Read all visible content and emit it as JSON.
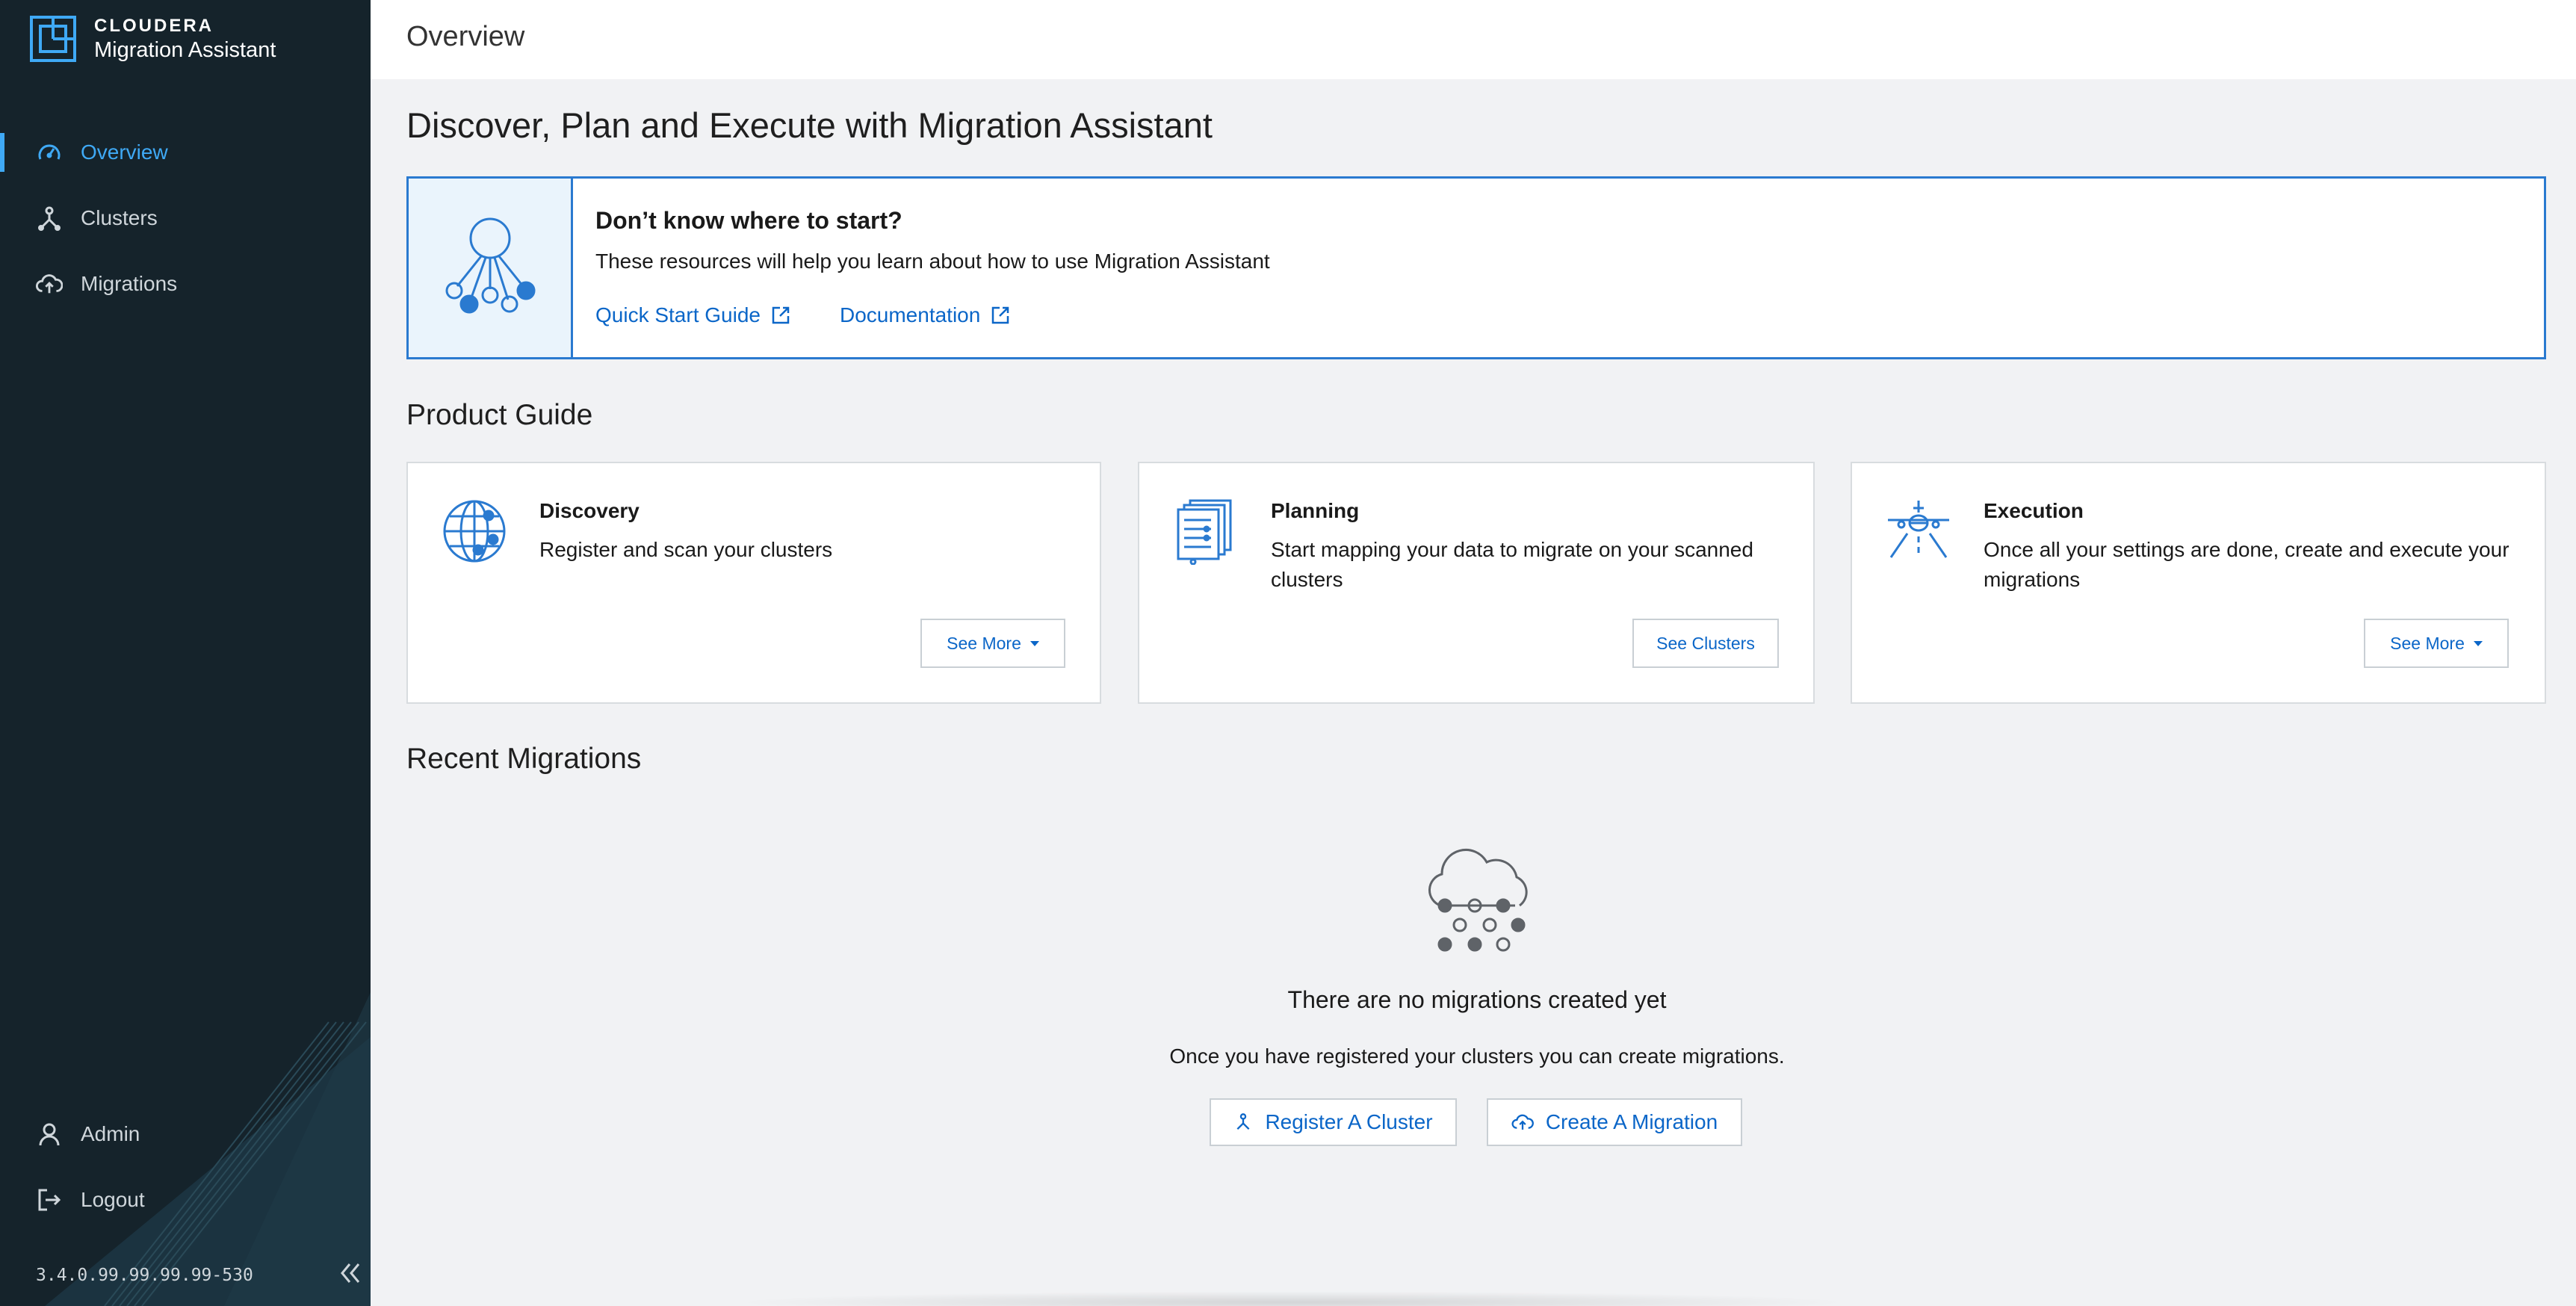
{
  "brand": {
    "top": "CLOUDERA",
    "sub": "Migration Assistant"
  },
  "sidebar": {
    "items": [
      {
        "label": "Overview",
        "icon": "speedometer-icon",
        "active": true
      },
      {
        "label": "Clusters",
        "icon": "cluster-icon",
        "active": false
      },
      {
        "label": "Migrations",
        "icon": "cloud-upload-icon",
        "active": false
      }
    ],
    "bottom": [
      {
        "label": "Admin",
        "icon": "user-icon"
      },
      {
        "label": "Logout",
        "icon": "logout-icon"
      }
    ],
    "version": "3.4.0.99.99.99.99-530"
  },
  "header": {
    "title": "Overview"
  },
  "main": {
    "heading": "Discover, Plan and Execute with Migration Assistant",
    "resources": {
      "title": "Don’t know where to start?",
      "description": "These resources will help you learn about how to use Migration Assistant",
      "links": [
        {
          "label": "Quick Start Guide",
          "icon": "external-link-icon"
        },
        {
          "label": "Documentation",
          "icon": "external-link-icon"
        }
      ]
    },
    "product_guide": {
      "heading": "Product Guide",
      "cards": [
        {
          "title": "Discovery",
          "description": "Register and scan your clusters",
          "button": "See More",
          "icon": "globe-icon"
        },
        {
          "title": "Planning",
          "description": "Start mapping your data to migrate on your scanned clusters",
          "button": "See Clusters",
          "icon": "documents-icon"
        },
        {
          "title": "Execution",
          "description": "Once all your settings are done, create and execute your migrations",
          "button": "See More",
          "icon": "airplane-icon"
        }
      ]
    },
    "recent": {
      "heading": "Recent Migrations",
      "empty_title": "There are no migrations created yet",
      "empty_desc": "Once you have registered your clusters you can create migrations.",
      "buttons": [
        {
          "label": "Register A Cluster",
          "icon": "cluster-icon"
        },
        {
          "label": "Create A Migration",
          "icon": "cloud-upload-icon"
        }
      ]
    }
  },
  "colors": {
    "sidebar_bg": "#15232b",
    "accent": "#3fa9f5",
    "link": "#0b66c8",
    "resource_border": "#2a7ad0"
  }
}
